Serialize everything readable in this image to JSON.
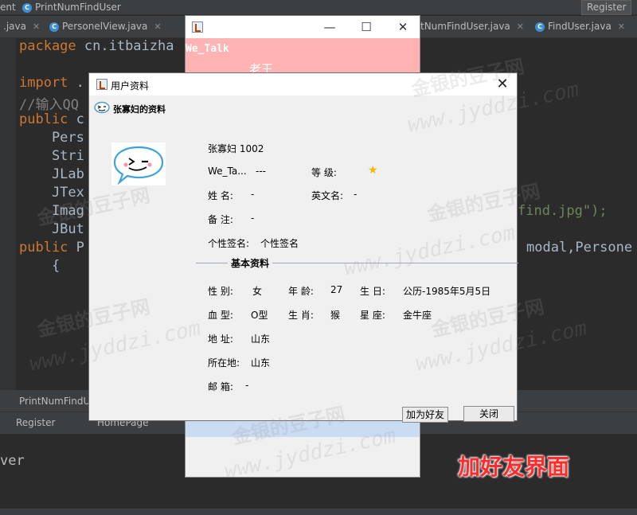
{
  "ide": {
    "crumbs": [
      "ent",
      "PrintNumFindUser"
    ],
    "run_button": "Register",
    "tabs": [
      ".java",
      "PersonelView.java",
      "tNumFindUser.java",
      "FindUser.java"
    ],
    "code_lines": [
      {
        "kw": "package",
        "rest": " cn.itbaizha"
      },
      {
        "kw": "import",
        "rest": " ."
      },
      {
        "cm": "//输入QQ"
      },
      {
        "kw": "public",
        "rest": " c"
      },
      {
        "rest": "    Pers"
      },
      {
        "rest": "    Stri"
      },
      {
        "rest": "    JLab"
      },
      {
        "rest": "    JTex"
      },
      {
        "rest": "    Imag"
      },
      {
        "rest": "    JBut"
      },
      {
        "kw": "public",
        "rest": " P"
      },
      {
        "rest": "    {"
      }
    ],
    "code_right_1": "find.jpg\");",
    "code_right_2": "modal,Persone",
    "bottom_tool_label": "PrintNumFindU",
    "bottom_tabs": [
      "Register",
      "HomePage"
    ],
    "console_text": "ver"
  },
  "back_window": {
    "brand": "We_Talk",
    "user": "老王"
  },
  "dialog": {
    "title": "用户资料",
    "banner": "张寡妇的资料",
    "name_id": "张寡妇 1002",
    "we_talk_label": "We_Ta...",
    "we_talk_value": "---",
    "level_label": "等    级:",
    "name_label": "姓    名:",
    "name_value": "-",
    "english_label": "英文名:",
    "english_value": "-",
    "note_label": "备    注:",
    "note_value": "-",
    "sign_label": "个性签名:",
    "sign_value": "个性签名",
    "section": "基本资料",
    "gender_label": "性    别:",
    "gender": "女",
    "age_label": "年    龄:",
    "age": "27",
    "birthday_label": "生    日:",
    "birthday": "公历-1985年5月5日",
    "blood_label": "血    型:",
    "blood": "O型",
    "zodiac_label": "生    肖:",
    "zodiac": "猴",
    "star_label": "星    座:",
    "star": "金牛座",
    "address_label": "地    址:",
    "address": "山东",
    "location_label": "所在地:",
    "location": "山东",
    "email_label": "邮    箱:",
    "email": "-",
    "add_button": "加为好友",
    "close_button": "关闭"
  },
  "watermark": {
    "site_cn": "金银的豆子网",
    "site_url": "www.jyddzi.com"
  },
  "caption": "加好友界面"
}
